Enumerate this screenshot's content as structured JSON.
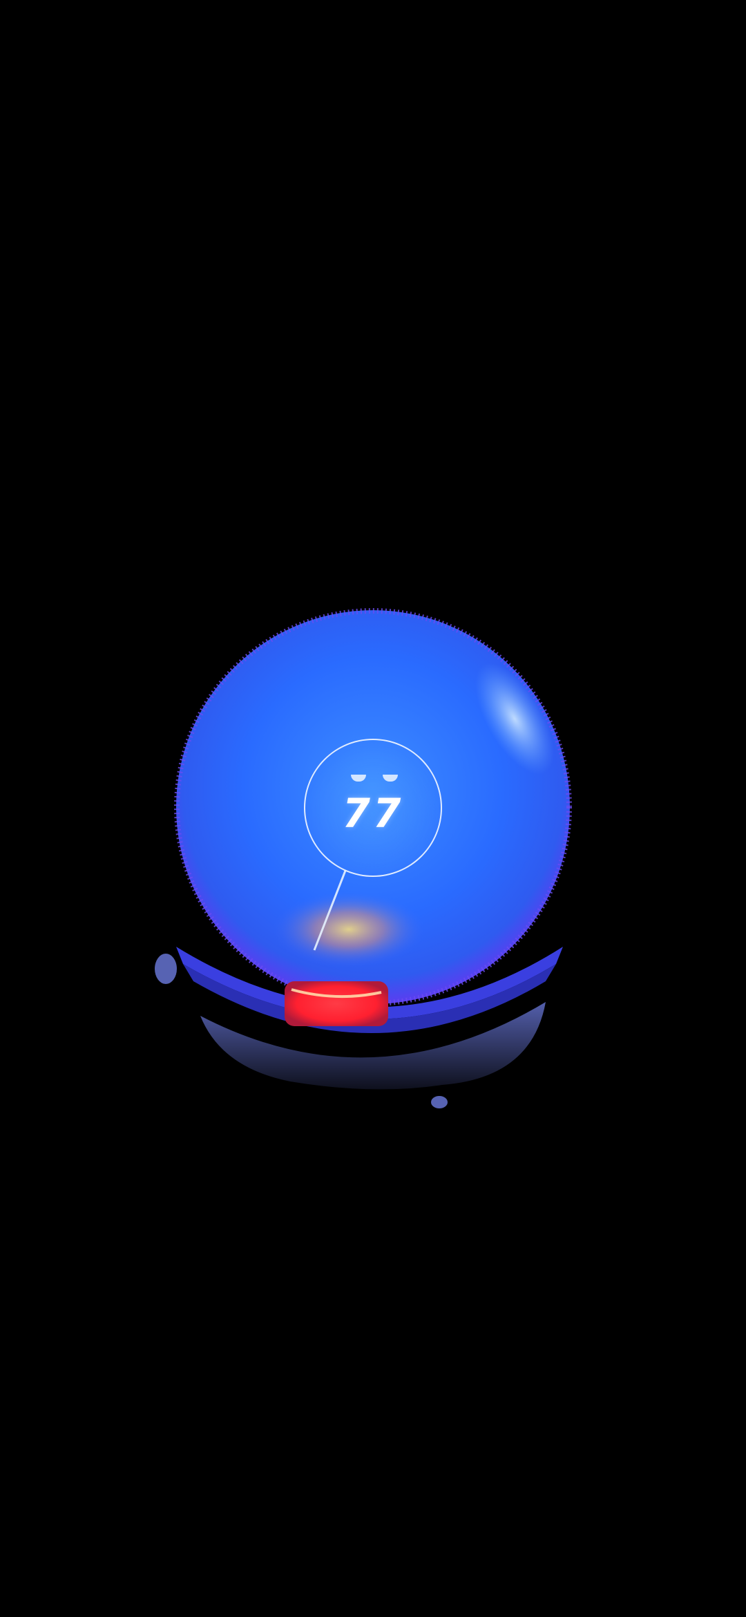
{
  "score": {
    "value": "77"
  },
  "icons": {
    "eyes": "closed-eyes-icon"
  },
  "colors": {
    "background": "#000000",
    "orb_primary": "#2f74ff",
    "orb_edge": "#5b3df0",
    "base_red": "#ff2b3a",
    "face_outline": "#ffffff"
  }
}
